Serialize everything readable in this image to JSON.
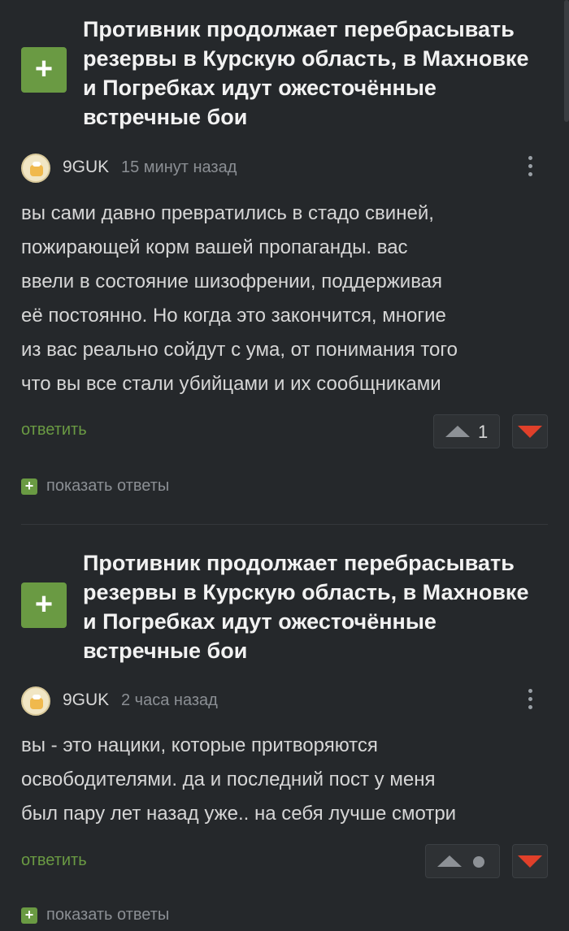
{
  "comments": [
    {
      "post_title": "Противник продолжает перебрасывать резервы в Курскую область, в Махновке и Погребках идут ожесточённые встречные бои",
      "plus_symbol": "+",
      "username": "9GUK",
      "time": "15 минут назад",
      "text_lines": [
        "вы сами давно превратились в стадо свиней,",
        "пожирающей корм вашей пропаганды. вас",
        "ввели в состояние шизофрении, поддерживая",
        "её постоянно. Но когда это закончится, многие",
        "из вас реально сойдут с ума, от понимания того",
        "что вы все стали убийцами и их сообщниками"
      ],
      "reply_label": "ответить",
      "rating": "1",
      "show_replies_label": "показать ответы"
    },
    {
      "post_title": "Противник продолжает перебрасывать резервы в Курскую область, в Махновке и Погребках идут ожесточённые встречные бои",
      "plus_symbol": "+",
      "username": "9GUK",
      "time": "2 часа назад",
      "text_lines": [
        "вы - это нацики, которые притворяются",
        "освободителями. да и последний пост у меня",
        "был пару лет назад уже.. на себя лучше смотри"
      ],
      "reply_label": "ответить",
      "rating": "",
      "show_replies_label": "показать ответы"
    }
  ],
  "colors": {
    "background": "#25282b",
    "accent_green": "#6a9a43",
    "downvote_red": "#e0402a"
  },
  "icons": [
    "plus-icon",
    "avatar",
    "more-vertical-icon",
    "upvote-icon",
    "downvote-icon",
    "neutral-dot-icon"
  ]
}
